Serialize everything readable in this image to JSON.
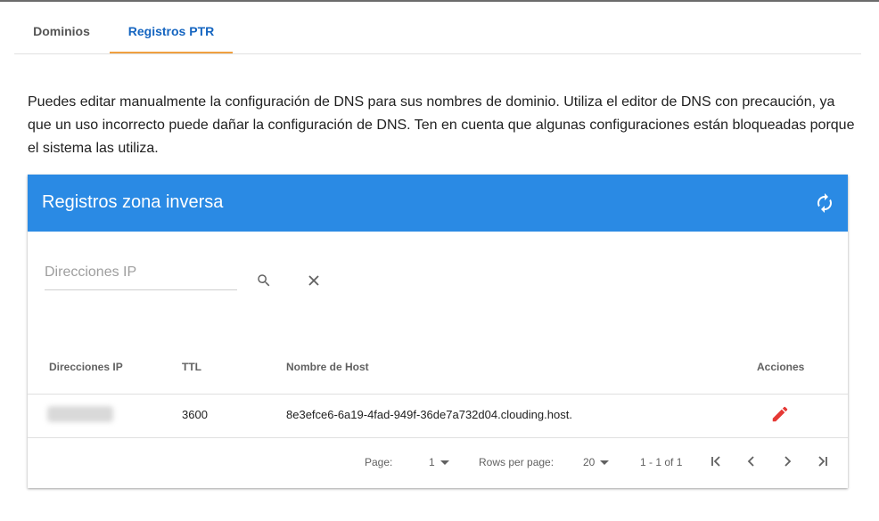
{
  "tabs": [
    {
      "label": "Dominios",
      "active": false
    },
    {
      "label": "Registros PTR",
      "active": true
    }
  ],
  "intro_text": "Puedes editar manualmente la configuración de DNS para sus nombres de dominio. Utiliza el editor de DNS con precaución, ya que un uso incorrecto puede dañar la configuración de DNS. Ten en cuenta que algunas configuraciones están bloqueadas porque el sistema las utiliza.",
  "card": {
    "title": "Registros zona inversa",
    "header_color": "#2a8ae4",
    "icons": {
      "refresh": "refresh-icon"
    }
  },
  "search": {
    "placeholder": "Direcciones IP",
    "value": ""
  },
  "table": {
    "columns": [
      "Direcciones IP",
      "TTL",
      "Nombre de Host",
      "Acciones"
    ],
    "rows": [
      {
        "ip": "",
        "ttl": "3600",
        "host": "8e3efce6-6a19-4fad-949f-36de7a732d04.clouding.host."
      }
    ]
  },
  "pagination": {
    "page_label": "Page:",
    "page_value": "1",
    "rows_label": "Rows per page:",
    "rows_value": "20",
    "range": "1 - 1 of 1"
  },
  "colors": {
    "accent": "#1565c0",
    "tab_indicator": "#f0a040",
    "edit": "#e53935"
  }
}
